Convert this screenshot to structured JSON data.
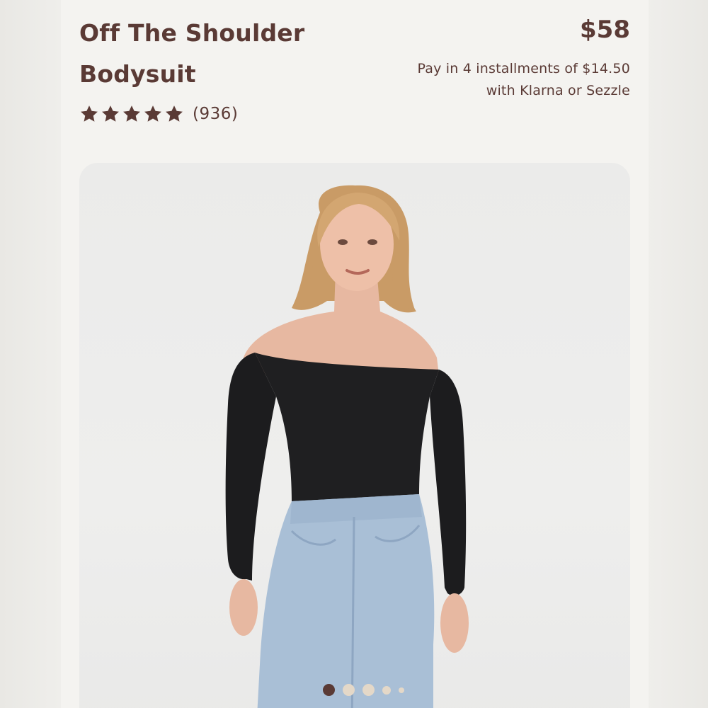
{
  "product": {
    "title_line1": "Off The Shoulder",
    "title_line2": "Bodysuit",
    "price": "$58",
    "installments_line1": "Pay in 4 installments of $14.50",
    "installments_line2": "with Klarna or Sezzle",
    "rating": {
      "stars": 5,
      "review_count": "(936)",
      "icon": "star-icon"
    },
    "image": {
      "subject": "model-photo",
      "active_slide": 1,
      "slide_count": 5
    }
  },
  "colors": {
    "brand_text": "#5a3a35",
    "page_bg": "#f4f3f0",
    "dot_inactive": "#e4d8c8"
  }
}
